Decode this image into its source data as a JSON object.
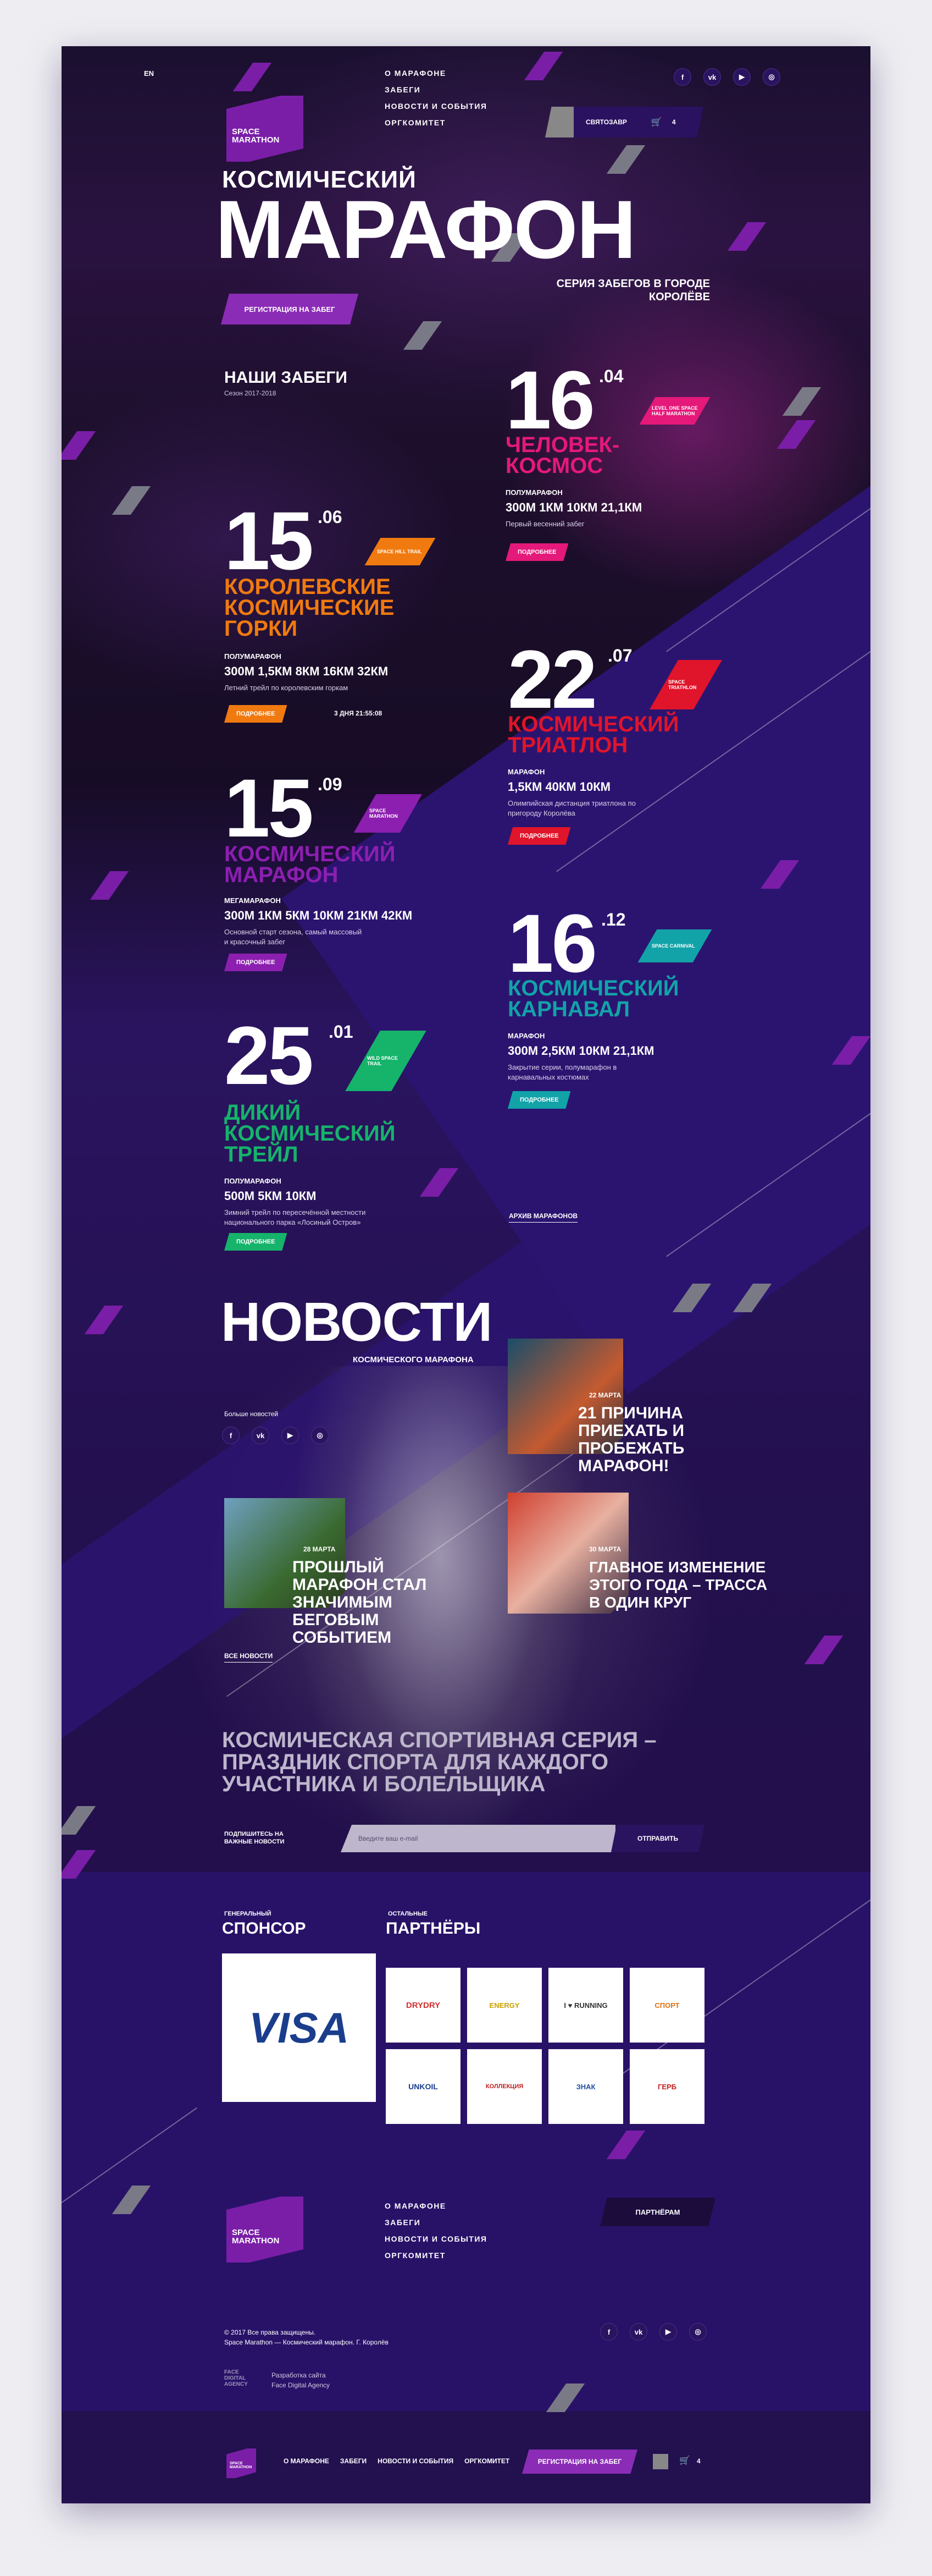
{
  "header": {
    "lang": "EN",
    "logo_line1": "SPACE",
    "logo_line2": "MARATHON",
    "nav": [
      "О марафоне",
      "Забеги",
      "Новости и события",
      "Оргкомитет"
    ],
    "user_name": "СВЯТОЗАВР",
    "cart_count": "4",
    "social": [
      "f",
      "vk",
      "yt",
      "ig"
    ]
  },
  "hero": {
    "title_small": "КОСМИЧЕСКИЙ",
    "title_big": "МАРАФОН",
    "subtitle": "СЕРИЯ ЗАБЕГОВ В ГОРОДЕ КОРОЛЁВЕ",
    "register_btn": "РЕГИСТРАЦИЯ НА ЗАБЕГ"
  },
  "races_section": {
    "title": "НАШИ ЗАБЕГИ",
    "season": "Сезон 2017-2018",
    "archive_link": "АРХИВ МАРАФОНОВ"
  },
  "races": [
    {
      "day": "16",
      "month": ".04",
      "title": "ЧЕЛОВЕК-КОСМОС",
      "tag": "LEVEL ONE SPACE HALF MARATHON",
      "type": "ПОЛУМАРАФОН",
      "distances": "300М 1КМ 10КМ 21,1КМ",
      "desc": "Первый весенний забег",
      "button": "ПОДРОБНЕЕ",
      "color": "#e5197a"
    },
    {
      "day": "15",
      "month": ".06",
      "title": "КОРОЛЕВСКИЕ КОСМИЧЕСКИЕ ГОРКИ",
      "tag": "SPACE HILL TRAIL",
      "type": "ПОЛУМАРАФОН",
      "distances": "300М 1,5КМ 8КМ 16КМ 32КМ",
      "desc": "Летний трейл по королевским горкам",
      "button": "ПОДРОБНЕЕ",
      "timer": "3 ДНЯ 21:55:08",
      "color": "#f07a10"
    },
    {
      "day": "22",
      "month": ".07",
      "title": "КОСМИЧЕСКИЙ ТРИАТЛОН",
      "tag": "SPACE TRIATHLON",
      "type": "МАРАФОН",
      "distances": "1,5КМ 40КМ 10КМ",
      "desc": "Олимпийская дистанция триатлона по пригороду Королёва",
      "button": "ПОДРОБНЕЕ",
      "color": "#e0142a"
    },
    {
      "day": "15",
      "month": ".09",
      "title": "КОСМИЧЕСКИЙ МАРАФОН",
      "tag": "SPACE MARATHON",
      "type": "МЕГАМАРАФОН",
      "distances": "300М 1КМ 5КМ 10КМ 21КМ 42КМ",
      "desc": "Основной старт сезона, самый массовый и красочный забег",
      "button": "ПОДРОБНЕЕ",
      "color": "#8c1fb0"
    },
    {
      "day": "16",
      "month": ".12",
      "title": "КОСМИЧЕСКИЙ КАРНАВАЛ",
      "tag": "SPACE CARNIVAL",
      "type": "МАРАФОН",
      "distances": "300М 2,5КМ 10КМ 21,1КМ",
      "desc": "Закрытие серии, полумарафон в карнавальных костюмах",
      "button": "ПОДРОБНЕЕ",
      "color": "#12a3a8"
    },
    {
      "day": "25",
      "month": ".01",
      "title": "ДИКИЙ КОСМИЧЕСКИЙ ТРЕЙЛ",
      "tag": "WILD SPACE TRAIL",
      "type": "ПОЛУМАРАФОН",
      "distances": "500М 5КМ 10КМ",
      "desc": "Зимний трейл по пересечённой местности национального парка «Лосиный Остров»",
      "button": "ПОДРОБНЕЕ",
      "color": "#16b36b"
    }
  ],
  "news": {
    "title": "НОВОСТИ",
    "subtitle": "КОСМИЧЕСКОГО МАРАФОНА",
    "more": "Больше новостей",
    "all": "ВСЕ НОВОСТИ",
    "items": [
      {
        "date": "22 МАРТА",
        "title": "21 ПРИЧИНА ПРИЕХАТЬ И ПРОБЕЖАТЬ МАРАФОН!"
      },
      {
        "date": "28 МАРТА",
        "title": "ПРОШЛЫЙ МАРАФОН СТАЛ ЗНАЧИМЫМ БЕГОВЫМ СОБЫТИЕМ"
      },
      {
        "date": "30 МАРТА",
        "title": "ГЛАВНОЕ ИЗМЕНЕНИЕ ЭТОГО ГОДА – ТРАССА В ОДИН КРУГ"
      }
    ]
  },
  "subscribe": {
    "headline": "КОСМИЧЕСКАЯ СПОРТИВНАЯ СЕРИЯ – ПРАЗДНИК СПОРТА ДЛЯ КАЖДОГО УЧАСТНИКА И БОЛЕЛЬЩИКА",
    "label": "ПОДПИШИТЕСЬ НА ВАЖНЫЕ НОВОСТИ",
    "placeholder": "Введите ваш e-mail",
    "button": "ОТПРАВИТЬ"
  },
  "sponsors": {
    "general_small": "ГЕНЕРАЛЬНЫЙ",
    "general_big": "СПОНСОР",
    "general_name": "VISA",
    "others_small": "ОСТАЛЬНЫЕ",
    "others_big": "ПАРТНЁРЫ",
    "partners": [
      "DRYDRY",
      "ENERGY",
      "I ♥ RUNNING",
      "СПОРТ",
      "UNKOIL",
      "КОЛЛЕКЦИЯ",
      "ЗНАК",
      "ГЕРБ"
    ]
  },
  "footer": {
    "nav": [
      "О марафоне",
      "Забеги",
      "Новости и события",
      "Оргкомитет"
    ],
    "partners_btn": "ПАРТНЁРАМ",
    "copyright1": "© 2017 Все права защищены.",
    "copyright2": "Space Marathon — Космический марафон. Г. Королёв",
    "dev_logo": "FACE DIGITAL AGENCY",
    "dev1": "Разработка сайта",
    "dev2": "Face Digital Agency"
  },
  "sticky": {
    "nav": [
      "О МАРАФОНЕ",
      "ЗАБЕГИ",
      "НОВОСТИ И СОБЫТИЯ",
      "ОРГКОМИТЕТ"
    ],
    "register_btn": "РЕГИСТРАЦИЯ НА ЗАБЕГ",
    "cart_count": "4"
  }
}
